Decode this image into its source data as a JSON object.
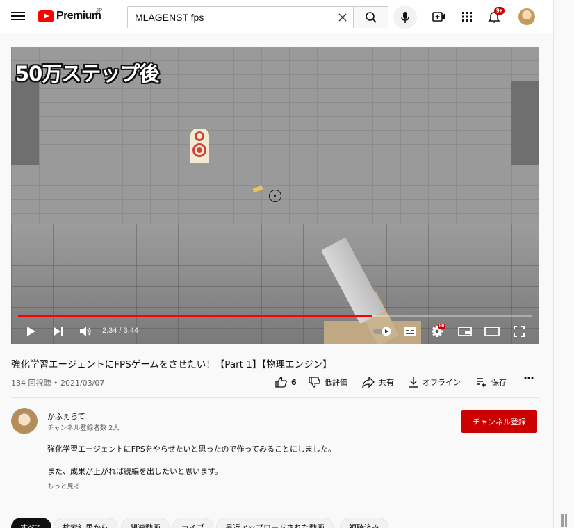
{
  "masthead": {
    "logo_text": "Premium",
    "logo_region": "JP",
    "search_value": "MLAGENST fps",
    "notification_count": "9+"
  },
  "player": {
    "overlay_title": "50万ステップ後",
    "time_current": "2:34",
    "time_separator": " / ",
    "time_total": "3:44",
    "progress_fraction": 0.688,
    "hd_label": "HD"
  },
  "video": {
    "title": "強化学習エージェントにFPSゲームをさせたい！【Part 1】【物理エンジン】",
    "meta": "134 回視聴 • 2021/03/07",
    "like_count": "6",
    "dislike_label": "低評価",
    "share_label": "共有",
    "offline_label": "オフライン",
    "save_label": "保存"
  },
  "channel": {
    "name": "かふぇらて",
    "subscribers": "チャンネル登録者数 2人",
    "subscribe_label": "チャンネル登録"
  },
  "description": {
    "line1": "強化学習エージェントにFPSをやらせたいと思ったので作ってみることにしました。",
    "line2": "また、成果が上がれば続編を出したいと思います。",
    "show_more": "もっと見る"
  },
  "chips": [
    {
      "label": "すべて"
    },
    {
      "label": "検索結果から"
    },
    {
      "label": "関連動画"
    },
    {
      "label": "ライブ"
    },
    {
      "label": "最近アップロードされた動画"
    },
    {
      "label": "視聴済み"
    }
  ],
  "colors": {
    "brand_red": "#ff0000",
    "subscribe_red": "#cc0000",
    "progress_red": "#ff0000"
  }
}
